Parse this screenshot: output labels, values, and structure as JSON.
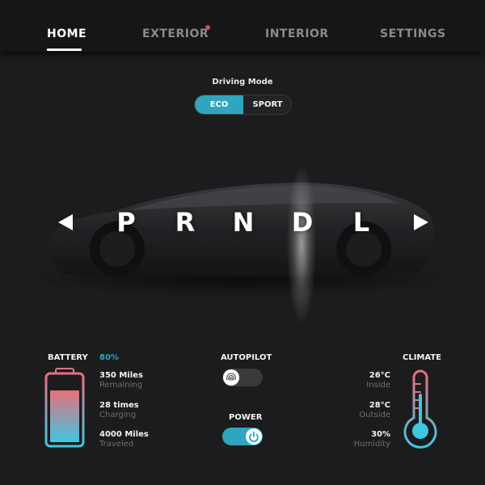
{
  "nav": {
    "tabs": [
      {
        "label": "HOME",
        "active": true
      },
      {
        "label": "EXTERIOR",
        "active": false,
        "notification": true
      },
      {
        "label": "INTERIOR",
        "active": false
      },
      {
        "label": "SETTINGS",
        "active": false
      }
    ]
  },
  "driving_mode": {
    "title": "Driving Mode",
    "options": [
      "ECO",
      "SPORT"
    ],
    "selected": "ECO"
  },
  "gear_selector": {
    "gears": [
      "P",
      "R",
      "N",
      "D",
      "L"
    ],
    "selected": "D",
    "left_arrow_icon": "left-arrow-icon",
    "right_arrow_icon": "right-arrow-icon"
  },
  "battery": {
    "title": "BATTERY",
    "percent": "80%",
    "level": 0.8,
    "stats": [
      {
        "value": "350 Miles",
        "label": "Remaining"
      },
      {
        "value": "28 times",
        "label": "Charging"
      },
      {
        "value": "4000 Miles",
        "label": "Traveled"
      }
    ]
  },
  "autopilot": {
    "title": "AUTOPILOT",
    "state": "off",
    "icon": "fingerprint-icon"
  },
  "power": {
    "title": "POWER",
    "state": "on",
    "icon": "power-icon"
  },
  "climate": {
    "title": "CLIMATE",
    "stats": [
      {
        "value": "26°C",
        "label": "Inside"
      },
      {
        "value": "28°C",
        "label": "Outside"
      },
      {
        "value": "30%",
        "label": "Humidity"
      }
    ],
    "icon": "thermometer-icon"
  },
  "colors": {
    "accent": "#2fa6bd",
    "notification": "#e14848",
    "battery_top": "#e8707a",
    "battery_bottom": "#3fc6e0",
    "background": "#1c1c1e"
  }
}
